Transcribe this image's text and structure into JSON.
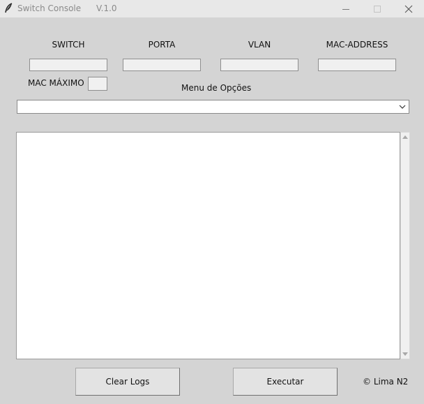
{
  "window": {
    "title": "Switch Console",
    "version": "V.1.0"
  },
  "form": {
    "switch_label": "SWITCH",
    "porta_label": "PORTA",
    "vlan_label": "VLAN",
    "mac_address_label": "MAC-ADDRESS",
    "mac_maximo_label": "MAC MÁXIMO",
    "switch_value": "",
    "porta_value": "",
    "vlan_value": "",
    "mac_address_value": "",
    "mac_maximo_value": ""
  },
  "menu": {
    "label": "Menu de Opções",
    "selected": ""
  },
  "log": {
    "content": ""
  },
  "buttons": {
    "clear_logs": "Clear Logs",
    "executar": "Executar"
  },
  "footer": {
    "copyright": "© Lima N2"
  },
  "icons": {
    "app": "feather-icon",
    "minimize": "minimize-icon",
    "maximize": "maximize-icon",
    "close": "close-icon",
    "dropdown": "chevron-down-icon"
  }
}
